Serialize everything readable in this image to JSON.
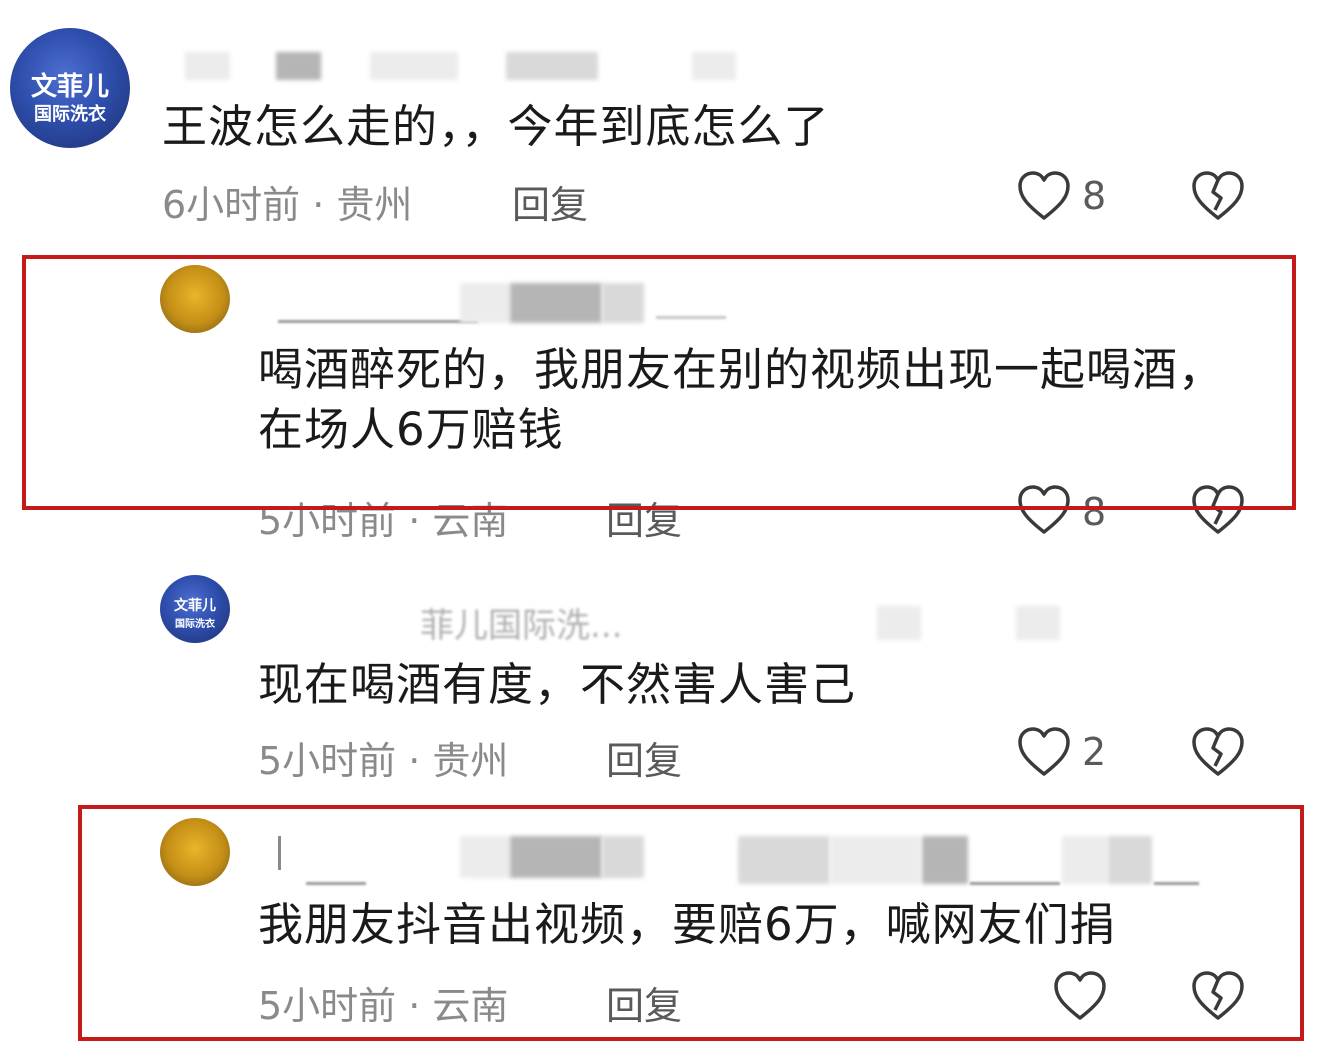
{
  "colors": {
    "highlight": "#c41a1a",
    "meta_text": "#8a8a8a",
    "body_text": "#1a1a1a"
  },
  "comments": [
    {
      "avatar": {
        "text_top": "文菲儿",
        "text_bottom": "国际洗衣"
      },
      "text": "王波怎么走的，，今年到底怎么了",
      "time": "6小时前 · 贵州",
      "reply": "回复",
      "likes": "8"
    },
    {
      "text": "喝酒醉死的，我朋友在别的视频出现一起喝酒，在场人6万赔钱",
      "time": "5小时前 · 云南",
      "reply": "回复",
      "likes": "8"
    },
    {
      "avatar": {
        "text_top": "文菲儿",
        "text_bottom": "国际洗衣"
      },
      "username_partial": "菲儿国际洗...",
      "text": "现在喝酒有度，不然害人害己",
      "time": "5小时前 · 贵州",
      "reply": "回复",
      "likes": "2"
    },
    {
      "text": "我朋友抖音出视频，要赔6万，喊网友们捐",
      "time": "5小时前 · 云南",
      "reply": "回复",
      "likes": ""
    }
  ]
}
